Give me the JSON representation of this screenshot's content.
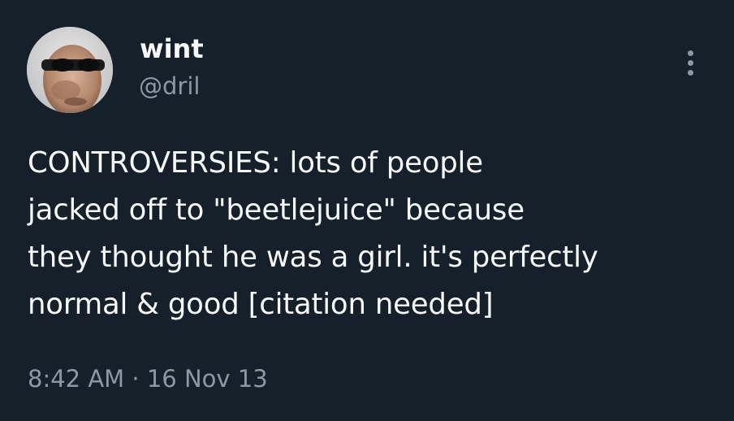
{
  "author": {
    "display_name": "wint",
    "handle": "@dril",
    "avatar_icon": "profile-photo"
  },
  "menu": {
    "icon": "more-options-icon"
  },
  "tweet": {
    "lines": [
      "CONTROVERSIES: lots of people",
      "jacked off to \"beetlejuice\" because",
      "they thought he was a girl. it's perfectly",
      "normal & good [citation needed]"
    ]
  },
  "meta": {
    "time": "8:42 AM",
    "separator": "·",
    "date": "16 Nov 13"
  },
  "colors": {
    "background": "#15202b",
    "text_primary": "#f7f9f9",
    "text_secondary": "#8b98a5"
  }
}
